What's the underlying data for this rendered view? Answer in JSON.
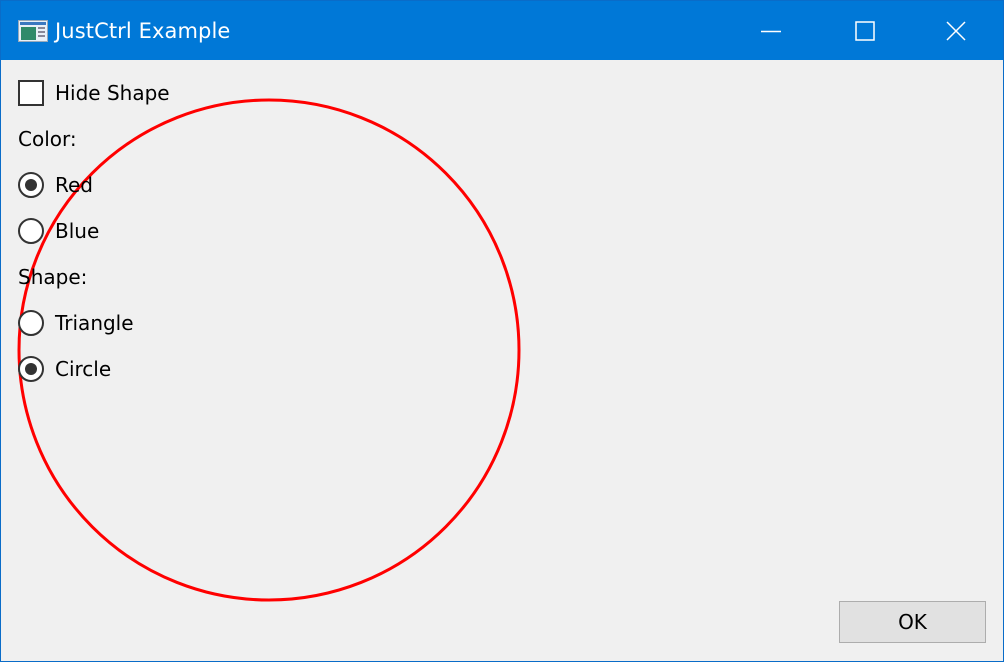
{
  "window": {
    "title": "JustCtrl Example",
    "accent_color": "#0078d7",
    "app_icon": "window-app-icon",
    "controls": [
      "minimize-icon",
      "maximize-icon",
      "close-icon"
    ]
  },
  "hide_shape": {
    "label": "Hide Shape",
    "checked": false
  },
  "color": {
    "label": "Color:",
    "options": [
      {
        "label": "Red",
        "checked": true
      },
      {
        "label": "Blue",
        "checked": false
      }
    ]
  },
  "shape": {
    "label": "Shape:",
    "options": [
      {
        "label": "Triangle",
        "checked": false
      },
      {
        "label": "Circle",
        "checked": true
      }
    ]
  },
  "canvas": {
    "shape": "circle",
    "stroke_color": "#ff0000"
  },
  "ok_label": "OK"
}
